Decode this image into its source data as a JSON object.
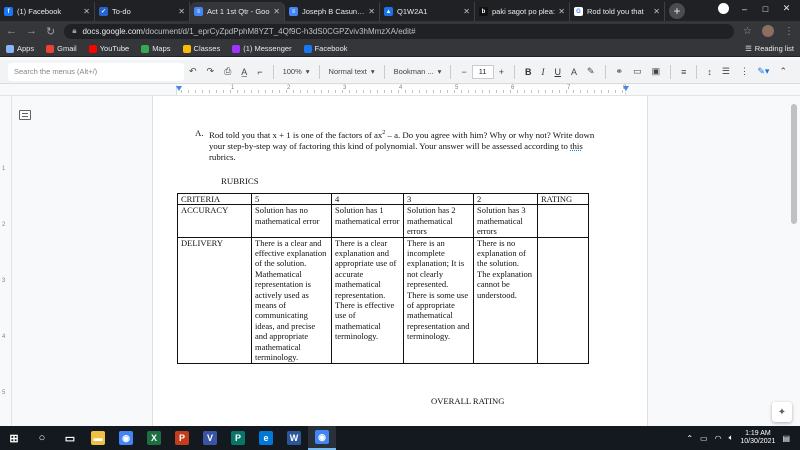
{
  "browser": {
    "tabs": [
      {
        "title": "(1) Facebook",
        "icon": "facebook-icon",
        "color": "#1877f2",
        "glyph": "f"
      },
      {
        "title": "To-do",
        "icon": "todo-icon",
        "color": "#2564cf",
        "glyph": "✓"
      },
      {
        "title": "Act 1 1st Qtr - Goo",
        "icon": "docs-icon",
        "color": "#4285f4",
        "glyph": "≡"
      },
      {
        "title": "Joseph B Casuncad",
        "icon": "docs-icon",
        "color": "#4285f4",
        "glyph": "≡"
      },
      {
        "title": "Q1W2A1",
        "icon": "classroom-icon",
        "color": "#1a73e8",
        "glyph": "▲"
      },
      {
        "title": "paki sagot po plea:",
        "icon": "brainly-icon",
        "color": "#111111",
        "glyph": "b"
      },
      {
        "title": "Rod told you that",
        "icon": "google-icon",
        "color": "#ffffff",
        "glyph": "G"
      }
    ],
    "active_tab_index": 2,
    "url_host": "docs.google.com",
    "url_path": "/document/d/1_eprCyZpdPphM8YZT_4Qf9C-h3dS0CGPZviv3hMmzXA/edit#",
    "bookmarks": [
      {
        "label": "Apps",
        "color": "#8ab4f8"
      },
      {
        "label": "Gmail",
        "color": "#ea4335"
      },
      {
        "label": "YouTube",
        "color": "#ff0000"
      },
      {
        "label": "Maps",
        "color": "#34a853"
      },
      {
        "label": "Classes",
        "color": "#fbbc04"
      },
      {
        "label": "(1) Messenger",
        "color": "#a033ff"
      },
      {
        "label": "Facebook",
        "color": "#1877f2"
      }
    ],
    "reading_list": "Reading list"
  },
  "docs_toolbar": {
    "search_placeholder": "Search the menus (Alt+/)",
    "zoom": "100%",
    "style": "Normal text",
    "font": "Bookman ...",
    "font_size": "11"
  },
  "ruler": {
    "numbers": [
      "1",
      "2",
      "3",
      "4",
      "5",
      "6",
      "7",
      "8"
    ]
  },
  "vruler": {
    "numbers": [
      "1",
      "2",
      "3",
      "4",
      "5"
    ]
  },
  "document": {
    "question_label": "A.",
    "question_pre": "Rod told you that x + 1 is one of the factors of ax",
    "question_sup": "2",
    "question_mid": " – a. Do you agree with him? Why or why not? Write down your step-by-step way of factoring this kind of polynomial. Your answer will be assessed according to ",
    "question_spell": "this",
    "question_post": " rubrics.",
    "rubrics_title": "RUBRICS",
    "table": {
      "headers": [
        "CRITERIA",
        "5",
        "4",
        "3",
        "2",
        "RATING"
      ],
      "rows": [
        [
          "ACCURACY",
          "Solution has no mathematical error",
          "Solution has 1 mathematical error",
          "Solution has 2 mathematical errors",
          "Solution has 3 mathematical errors",
          ""
        ],
        [
          "DELIVERY",
          "There is a clear and effective explanation of the solution. Mathematical representation is actively used as means of communicating ideas, and precise and appropriate mathematical terminology.",
          "There is a clear explanation and appropriate use of accurate mathematical representation. There is effective use of mathematical terminology.",
          "There is an incomplete explanation; It is not clearly represented. There is some use of appropriate mathematical representation and terminology.",
          "There is no explanation of the solution. The explanation cannot be understood.",
          ""
        ]
      ]
    },
    "overall_rating": "OVERALL RATING"
  },
  "taskbar": {
    "apps": [
      {
        "name": "windows-start-icon",
        "color": "#ffffff",
        "glyph": "⊞"
      },
      {
        "name": "search-icon",
        "color": "#ffffff",
        "glyph": "○"
      },
      {
        "name": "task-view-icon",
        "color": "#ffffff",
        "glyph": "▭"
      },
      {
        "name": "file-explorer-icon",
        "color": "#f0c040",
        "glyph": "▬"
      },
      {
        "name": "chrome-icon",
        "color": "#4285f4",
        "glyph": "◉"
      },
      {
        "name": "excel-icon",
        "color": "#1d6f42",
        "glyph": "X"
      },
      {
        "name": "powerpoint-icon",
        "color": "#c43e1c",
        "glyph": "P"
      },
      {
        "name": "visio-icon",
        "color": "#3955a3",
        "glyph": "V"
      },
      {
        "name": "publisher-icon",
        "color": "#077568",
        "glyph": "P"
      },
      {
        "name": "edge-icon",
        "color": "#0078d7",
        "glyph": "e"
      },
      {
        "name": "word-icon",
        "color": "#2b579a",
        "glyph": "W"
      },
      {
        "name": "chrome-active-icon",
        "color": "#4285f4",
        "glyph": "◉"
      }
    ],
    "time": "1:19 AM",
    "date": "10/30/2021"
  }
}
